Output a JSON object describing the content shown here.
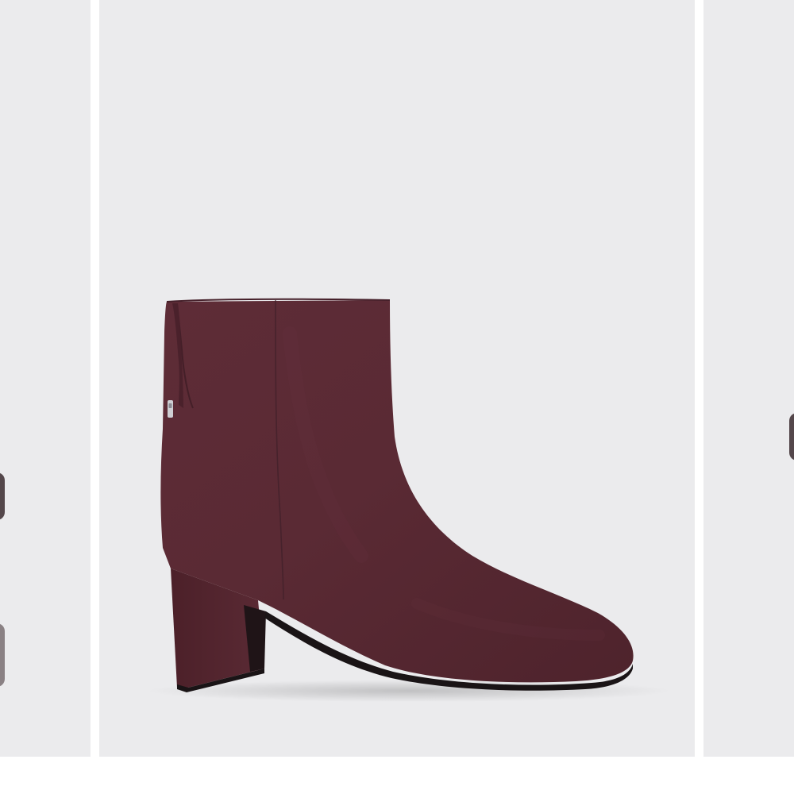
{
  "gallery": {
    "zoom_icon": "magnifier-zoom-icon",
    "colors": {
      "slide_background": "#ebebed",
      "page_background": "#ffffff",
      "suede": "#5a2a34",
      "sole": "#1a1416",
      "zipper": "#cfcfd4"
    }
  }
}
